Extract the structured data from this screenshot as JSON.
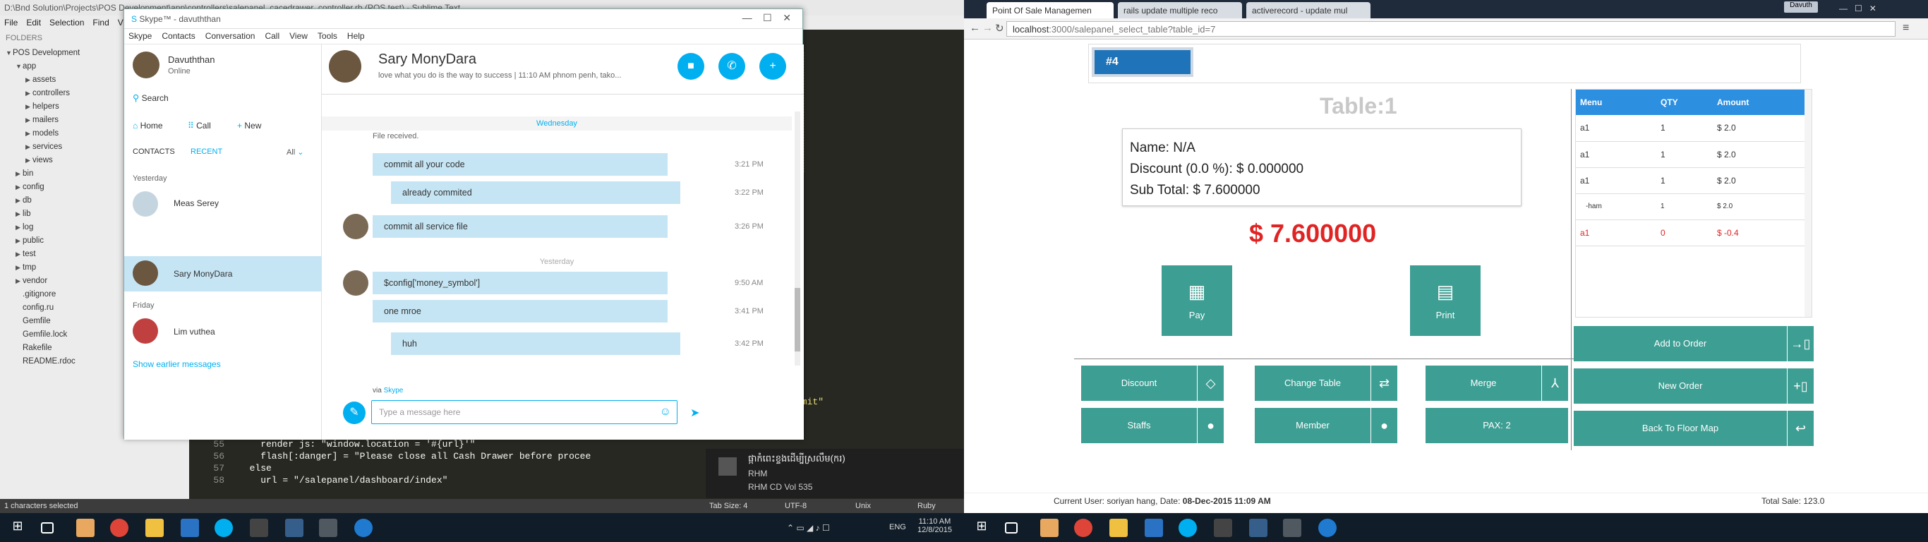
{
  "sublime": {
    "title": "D:\\Bnd Solution\\Projects\\POS Development\\app\\controllers\\salepanel_cacedrawer_controller.rb (POS test) - Sublime Text",
    "menu": [
      "File",
      "Edit",
      "Selection",
      "Find",
      "V"
    ],
    "folders_label": "FOLDERS",
    "tree": [
      {
        "label": "POS Development",
        "level": 0,
        "arrow": "▼"
      },
      {
        "label": "app",
        "level": 1,
        "arrow": "▼"
      },
      {
        "label": "assets",
        "level": 2,
        "arrow": "▶"
      },
      {
        "label": "controllers",
        "level": 2,
        "arrow": "▶"
      },
      {
        "label": "helpers",
        "level": 2,
        "arrow": "▶"
      },
      {
        "label": "mailers",
        "level": 2,
        "arrow": "▶"
      },
      {
        "label": "models",
        "level": 2,
        "arrow": "▶"
      },
      {
        "label": "services",
        "level": 2,
        "arrow": "▶"
      },
      {
        "label": "views",
        "level": 2,
        "arrow": "▶"
      },
      {
        "label": "bin",
        "level": 1,
        "arrow": "▶"
      },
      {
        "label": "config",
        "level": 1,
        "arrow": "▶"
      },
      {
        "label": "db",
        "level": 1,
        "arrow": "▶"
      },
      {
        "label": "lib",
        "level": 1,
        "arrow": "▶"
      },
      {
        "label": "log",
        "level": 1,
        "arrow": "▶"
      },
      {
        "label": "public",
        "level": 1,
        "arrow": "▶"
      },
      {
        "label": "test",
        "level": 1,
        "arrow": "▶"
      },
      {
        "label": "tmp",
        "level": 1,
        "arrow": "▶"
      },
      {
        "label": "vendor",
        "level": 1,
        "arrow": "▶"
      },
      {
        "label": ".gitignore",
        "level": 1,
        "arrow": ""
      },
      {
        "label": "config.ru",
        "level": 1,
        "arrow": ""
      },
      {
        "label": "Gemfile",
        "level": 1,
        "arrow": ""
      },
      {
        "label": "Gemfile.lock",
        "level": 1,
        "arrow": ""
      },
      {
        "label": "Rakefile",
        "level": 1,
        "arrow": ""
      },
      {
        "label": "README.rdoc",
        "level": 1,
        "arrow": ""
      }
    ],
    "code_lines": [
      {
        "num": "55",
        "text": "    render js: \"window.location = '#{url}'\""
      },
      {
        "num": "56",
        "text": "    flash[:danger] = \"Please close all Cash Drawer before procee"
      },
      {
        "num": "57",
        "text": "  else"
      },
      {
        "num": "58",
        "text": "    url = \"/salepanel/dashboard/index\""
      }
    ],
    "code_fragment": "mmit\"",
    "status_left": "1 characters selected",
    "status_tab": "Tab Size: 4",
    "status_enc": "UTF-8",
    "status_eol": "Unix",
    "status_syntax": "Ruby"
  },
  "skype": {
    "title": "Skype™ - davuththan",
    "menu": [
      "Skype",
      "Contacts",
      "Conversation",
      "Call",
      "View",
      "Tools",
      "Help"
    ],
    "user_name": "Davuththan",
    "user_status": "Online",
    "search_label": "Search",
    "home_label": "Home",
    "call_label": "Call",
    "new_label": "New",
    "tab_contacts": "CONTACTS",
    "tab_recent": "RECENT",
    "filter_all": "All",
    "group_yesterday": "Yesterday",
    "group_friday": "Friday",
    "contacts": [
      {
        "name": "Meas Serey"
      },
      {
        "name": "Sary MonyDara"
      },
      {
        "name": "Lim vuthea"
      }
    ],
    "show_earlier": "Show earlier messages",
    "chat_name": "Sary MonyDara",
    "chat_mood": "love what you do is the way to success | 11:10 AM phnom penh, tako...",
    "day_wednesday": "Wednesday",
    "day_yesterday": "Yesterday",
    "file_received": "File received.",
    "messages": [
      {
        "text": "commit all your code",
        "time": "3:21 PM"
      },
      {
        "text": "already commited",
        "time": "3:22 PM"
      },
      {
        "text": "commit all service file",
        "time": "3:26 PM"
      },
      {
        "text": "$config['money_symbol']",
        "time": "9:50 AM"
      },
      {
        "text": "one mroe",
        "time": "3:41 PM"
      },
      {
        "text": "huh",
        "time": "3:42 PM"
      }
    ],
    "via_label": "via",
    "via_skype": "Skype",
    "input_placeholder": "Type a message here"
  },
  "notification": {
    "title": "ផ្កាកំពេះខ្ទងដើម្បីស្រលឹម(ករ)",
    "artist": "RHM",
    "album": "RHM CD Vol 535"
  },
  "taskbar_left": {
    "time": "11:10 AM",
    "date": "12/8/2015",
    "lang": "ENG"
  },
  "chrome": {
    "tabs": [
      "Point Of Sale Managemen",
      "rails update multiple reco",
      "activerecord - update mul"
    ],
    "user_badge": "Davuth",
    "url_host": "localhost",
    "url_rest": ":3000/salepanel_select_table?table_id=7"
  },
  "pos": {
    "table_number": "#4",
    "table_title": "Table:1",
    "name_line": "Name: N/A",
    "discount_line": "Discount (0.0 %): $ 0.000000",
    "subtotal_line": "Sub Total: $ 7.600000",
    "total": "$ 7.600000",
    "pay_label": "Pay",
    "print_label": "Print",
    "order_headers": [
      "Menu",
      "QTY",
      "Amount"
    ],
    "order_rows": [
      {
        "menu": "a1",
        "qty": "1",
        "amount": "$ 2.0",
        "style": "normal"
      },
      {
        "menu": "a1",
        "qty": "1",
        "amount": "$ 2.0",
        "style": "normal"
      },
      {
        "menu": "a1",
        "qty": "1",
        "amount": "$ 2.0",
        "style": "normal"
      },
      {
        "menu": "-ham",
        "qty": "1",
        "amount": "$ 2.0",
        "style": "small"
      },
      {
        "menu": "a1",
        "qty": "0",
        "amount": "$ -0.4",
        "style": "red"
      }
    ],
    "buttons": {
      "discount": "Discount",
      "change_table": "Change Table",
      "merge": "Merge",
      "staffs": "Staffs",
      "member": "Member",
      "pax": "PAX: 2",
      "add_to_order": "Add to Order",
      "new_order": "New Order",
      "back_to_floor": "Back To Floor Map"
    },
    "footer_user_label": "Current User:",
    "footer_user": "soriyan hang",
    "footer_date_label": ", Date:",
    "footer_date": "08-Dec-2015 11:09 AM",
    "footer_total": "Total Sale: 123.0"
  },
  "colors": {
    "pos_teal": "#3d9e93",
    "pos_blue": "#1f74b9",
    "skype_blue": "#00aff0",
    "total_red": "#e02424"
  }
}
